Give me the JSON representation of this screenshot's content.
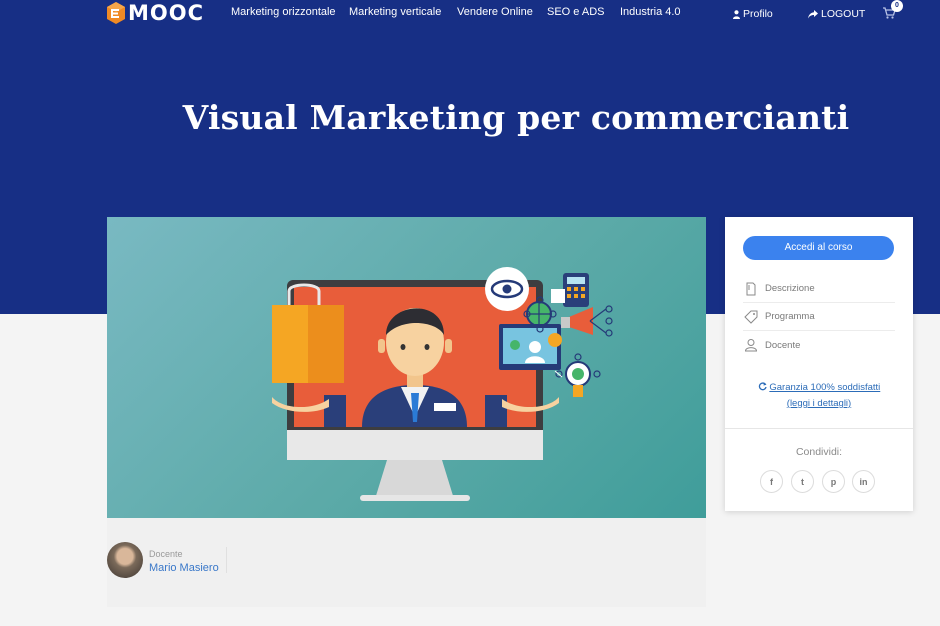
{
  "header": {
    "logo_text": "MOOC",
    "nav": [
      {
        "label": "Marketing orizzontale"
      },
      {
        "label": "Marketing verticale"
      },
      {
        "label": "Vendere Online"
      },
      {
        "label": "SEO e ADS"
      },
      {
        "label": "Industria 4.0"
      }
    ],
    "profile_label": "Profilo",
    "logout_label": "LOGOUT",
    "cart_count": "0"
  },
  "hero": {
    "title": "Visual Marketing per commercianti"
  },
  "course": {
    "teacher_role": "Docente",
    "teacher_name": "Mario Masiero"
  },
  "sidebar": {
    "access_button": "Accedi al corso",
    "menu": [
      {
        "label": "Descrizione",
        "icon": "document-icon"
      },
      {
        "label": "Programma",
        "icon": "tag-icon"
      },
      {
        "label": "Docente",
        "icon": "user-icon"
      }
    ],
    "guarantee_line1": "Garanzia 100% soddisfatti",
    "guarantee_line2": "(leggi i dettagli)",
    "share_label": "Condividi:",
    "social": [
      {
        "glyph": "f",
        "icon": "facebook-icon"
      },
      {
        "glyph": "t",
        "icon": "twitter-icon"
      },
      {
        "glyph": "p",
        "icon": "pinterest-icon"
      },
      {
        "glyph": "in",
        "icon": "linkedin-icon"
      }
    ]
  },
  "colors": {
    "hero_bg": "#172f85",
    "accent_button": "#3b82ee",
    "link": "#2c6cb8"
  }
}
